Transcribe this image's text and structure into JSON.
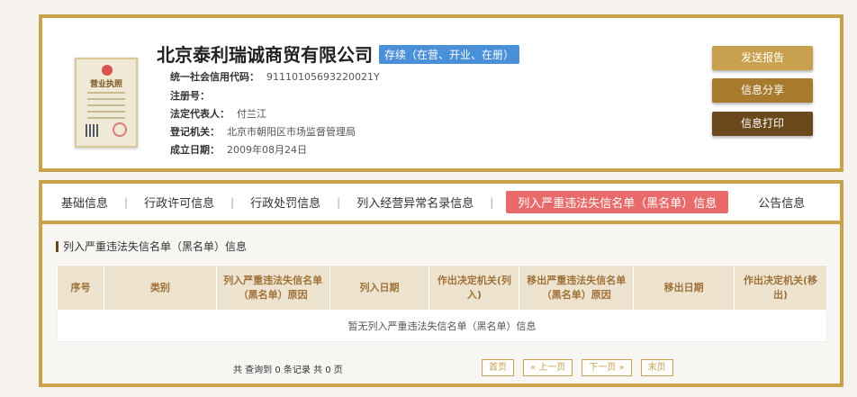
{
  "company": {
    "name": "北京泰利瑞诚商贸有限公司",
    "status": "存续（在营、开业、在册）",
    "license_title": "营业执照",
    "fields": [
      {
        "label": "统一社会信用代码：",
        "value": "91110105693220021Y"
      },
      {
        "label": "注册号：",
        "value": ""
      },
      {
        "label": "法定代表人：",
        "value": "付兰江"
      },
      {
        "label": "登记机关：",
        "value": "北京市朝阳区市场监督管理局"
      },
      {
        "label": "成立日期：",
        "value": "2009年08月24日"
      }
    ]
  },
  "actions": {
    "send_report": "发送报告",
    "share": "信息分享",
    "print": "信息打印"
  },
  "tabs": [
    {
      "label": "基础信息",
      "active": false
    },
    {
      "label": "行政许可信息",
      "active": false
    },
    {
      "label": "行政处罚信息",
      "active": false
    },
    {
      "label": "列入经营异常名录信息",
      "active": false
    },
    {
      "label": "列入严重违法失信名单（黑名单）信息",
      "active": true
    },
    {
      "label": "公告信息",
      "active": false
    }
  ],
  "tab_separator": "|",
  "section": {
    "title": "列入严重违法失信名单（黑名单）信息",
    "columns": [
      "序号",
      "类别",
      "列入严重违法失信名单（黑名单）原因",
      "列入日期",
      "作出决定机关(列入)",
      "移出严重违法失信名单（黑名单）原因",
      "移出日期",
      "作出决定机关(移出)"
    ],
    "empty_text": "暂无列入严重违法失信名单（黑名单）信息"
  },
  "pagination": {
    "summary": "共 查询到 0 条记录 共 0 页",
    "first": "首页",
    "prev": "« 上一页",
    "next": "下一页 »",
    "last": "末页"
  },
  "colors": {
    "gold_border": "#c9a24a",
    "badge_blue": "#4a90d9",
    "active_tab": "#e96a6a",
    "btn_send": "#c9a04e",
    "btn_share": "#a87a2e",
    "btn_print": "#6a4a1c"
  }
}
